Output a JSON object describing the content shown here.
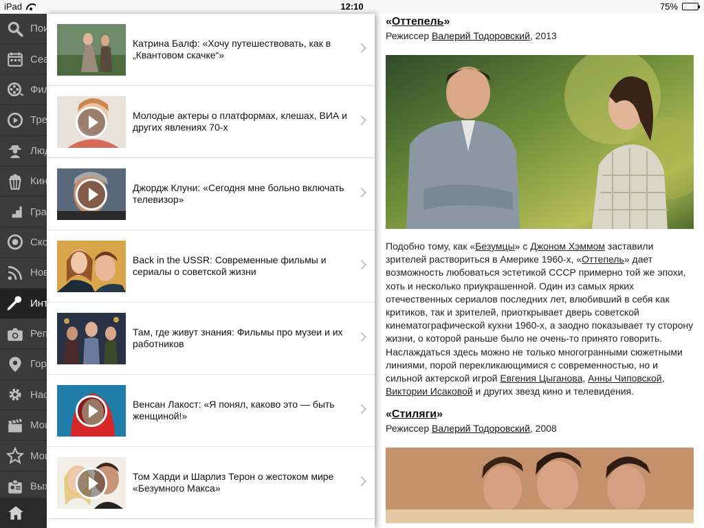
{
  "statusbar": {
    "device": "iPad",
    "time": "12:10",
    "battery": "75%",
    "battery_level": 0.75
  },
  "sidebar": {
    "items": [
      {
        "label": "Поиск",
        "icon": "search-icon"
      },
      {
        "label": "Сеансы",
        "icon": "calendar-icon"
      },
      {
        "label": "Фильмы",
        "icon": "film-reel-icon"
      },
      {
        "label": "Трейлеры",
        "icon": "play-icon"
      },
      {
        "label": "Люди",
        "icon": "person-hat-icon"
      },
      {
        "label": "Кинотеатры",
        "icon": "popcorn-icon"
      },
      {
        "label": "Графики",
        "icon": "stairs-icon"
      },
      {
        "label": "Скоро",
        "icon": "target-icon"
      },
      {
        "label": "Новости",
        "icon": "rss-icon"
      },
      {
        "label": "Интервью",
        "icon": "microphone-icon"
      },
      {
        "label": "Репортажи",
        "icon": "camera-icon"
      },
      {
        "label": "Город",
        "icon": "location-pin-icon"
      },
      {
        "label": "Настройки",
        "icon": "gear-icon"
      },
      {
        "label": "Мои фильмы",
        "icon": "clapperboard-icon"
      },
      {
        "label": "Мои звёзды",
        "icon": "star-icon"
      },
      {
        "label": "Выход",
        "icon": "id-badge-icon"
      }
    ],
    "active_index": 9,
    "home_icon": "home-icon"
  },
  "list": {
    "items": [
      {
        "title": "Катрина Балф: «Хочу путешествовать, как в „Квантовом скачке“»",
        "video": false
      },
      {
        "title": "Молодые актеры о платформах, клешах, ВИА и других явлениях 70-х",
        "video": true
      },
      {
        "title": "Джордж Клуни: «Сегодня мне больно включать телевизор»",
        "video": true
      },
      {
        "title": "Back in the USSR: Современные фильмы и сериалы о советской жизни",
        "video": false
      },
      {
        "title": "Там, где живут знания: Фильмы про музеи и их работников",
        "video": false
      },
      {
        "title": "Венсан Лакост: «Я понял, каково это — быть женщиной!»",
        "video": true
      },
      {
        "title": "Том Харди и Шарлиз Терон о жестоком мире «Безумного Макса»",
        "video": true
      }
    ]
  },
  "article": {
    "film1": {
      "quote_open": "«",
      "title": "Оттепель",
      "quote_close": "»",
      "director_prefix": "Режиссер ",
      "director": "Валерий Тодоровский",
      "year_suffix": ", 2013"
    },
    "body": {
      "p1": "Подобно тому, как «",
      "link1": "Безумцы",
      "p2": "» с ",
      "link2": "Джоном Хэммом",
      "p3": " заставили зрителей раствориться в Америке 1960-х, «",
      "link3": "Оттепель",
      "p4": "» дает возможность любоваться эстетикой СССР примерно той же эпохи, хоть и несколько приукрашенной. Один из самых ярких отечественных сериалов последних лет, влюбивший в себя как критиков, так и зрителей, приоткрывает дверь советской кинематографической кухни 1960-х, а заодно показывает ту сторону жизни, о которой раньше было не очень-то принято говорить. Наслаждаться здесь можно не только многогранными сюжетными линиями, порой перекликающимися с современностью, но и сильной актерской игрой ",
      "link4": "Евгения Цыганова",
      "p5": ", ",
      "link5": "Анны Чиповской",
      "p6": ", ",
      "link6": "Виктории Исаковой",
      "p7": " и других звезд кино и телевидения."
    },
    "film2": {
      "quote_open": "«",
      "title": "Стиляги",
      "quote_close": "»",
      "director_prefix": "Режиссер ",
      "director": "Валерий Тодоровский",
      "year_suffix": ", 2008"
    }
  }
}
